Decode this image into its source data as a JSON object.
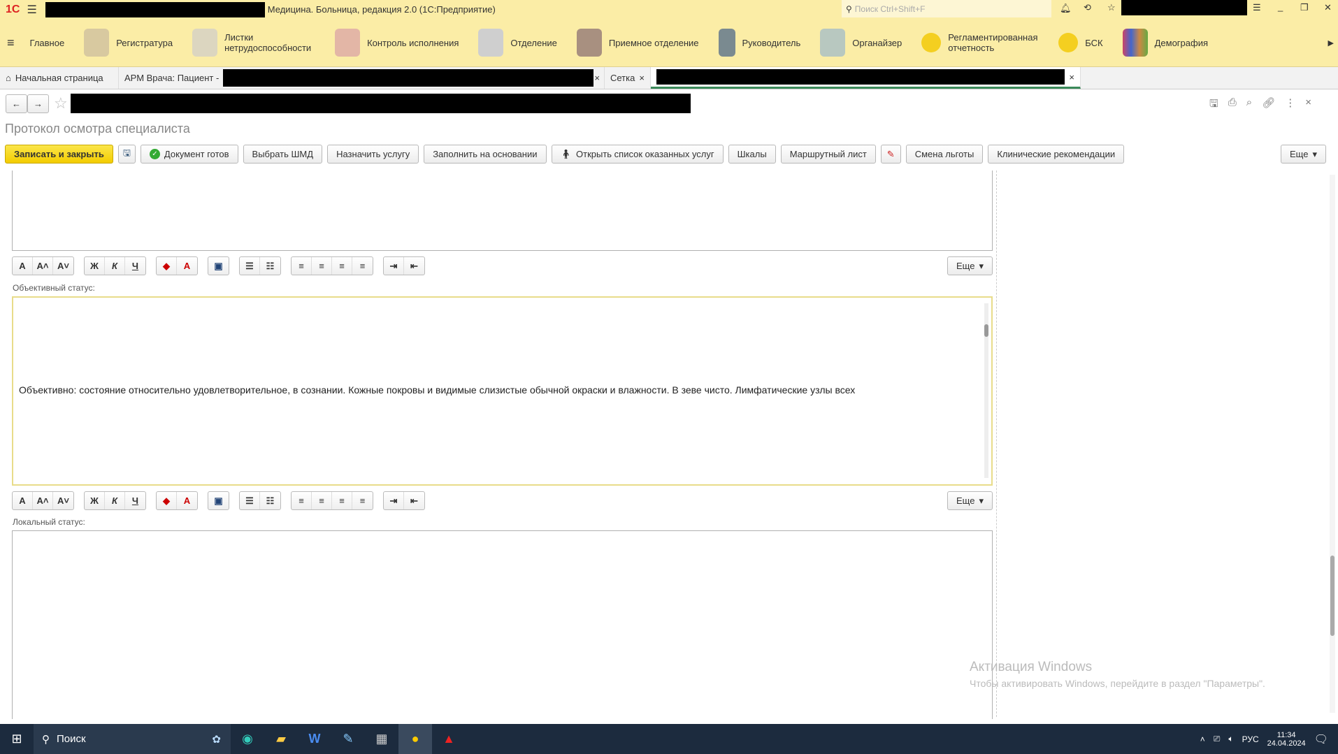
{
  "titlebar": {
    "logo": "1С",
    "title": "Медицина. Больница, редакция 2.0 (1С:Предприятие)",
    "search_placeholder": "Поиск Ctrl+Shift+F"
  },
  "sections": [
    "Главное",
    "Регистратура",
    "Листки нетрудоспособности",
    "Контроль исполнения",
    "Отделение",
    "Приемное отделение",
    "Руководитель",
    "Органайзер",
    "Регламентированная отчетность",
    "БСК",
    "Демография"
  ],
  "tabs": {
    "home": "Начальная страница",
    "arm": "АРМ Врача: Пациент -",
    "grid": "Сетка"
  },
  "form": {
    "title": "Протокол осмотра специалиста"
  },
  "toolbar": {
    "save_close": "Записать и закрыть",
    "doc_ready": "Документ готов",
    "shmd": "Выбрать ШМД",
    "assign": "Назначить услугу",
    "fill": "Заполнить на основании",
    "open_list": "Открыть список оказанных услуг",
    "scales": "Шкалы",
    "route": "Маршрутный лист",
    "benefit": "Смена льготы",
    "clinical": "Клинические рекомендации",
    "more": "Еще"
  },
  "fmt": {
    "a1": "A",
    "a2": "A˄",
    "a3": "A˅",
    "bold": "Ж",
    "italic": "К",
    "under": "Ч",
    "more": "Еще"
  },
  "fields": {
    "objective_label": "Объективный статус:",
    "objective_text": "Объективно: состояние относительно удовлетворительное, в сознании. Кожные покровы и видимые слизистые обычной окраски и влажности. В зеве чисто. Лимфатические узлы всех",
    "local_label": "Локальный статус:"
  },
  "watermark": {
    "title": "Активация Windows",
    "sub": "Чтобы активировать Windows, перейдите в раздел \"Параметры\"."
  },
  "taskbar": {
    "search": "Поиск",
    "lang": "РУС",
    "time": "11:34",
    "date": "24.04.2024"
  }
}
